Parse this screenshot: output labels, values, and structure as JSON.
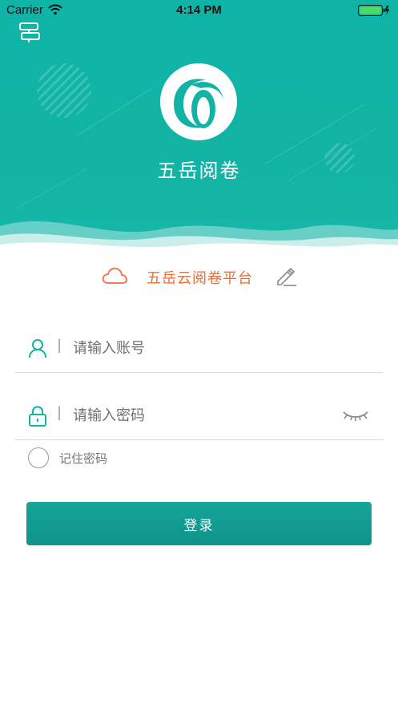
{
  "status_bar": {
    "carrier": "Carrier",
    "time": "4:14 PM"
  },
  "app": {
    "title": "五岳阅卷"
  },
  "platform": {
    "name": "五岳云阅卷平台"
  },
  "login_form": {
    "account_placeholder": "请输入账号",
    "password_placeholder": "请输入密码",
    "separator": "|",
    "remember_label": "记住密码",
    "remember_checked": false,
    "login_label": "登录"
  },
  "icons": {
    "route": "signpost-icon",
    "cloud": "cloud-icon",
    "edit": "pencil-icon",
    "user": "user-icon",
    "lock": "lock-icon",
    "eye": "eye-closed-icon"
  },
  "colors": {
    "header_teal": "#12b3a5",
    "accent_orange": "#f06a2e",
    "button_teal": "#0e9488"
  }
}
